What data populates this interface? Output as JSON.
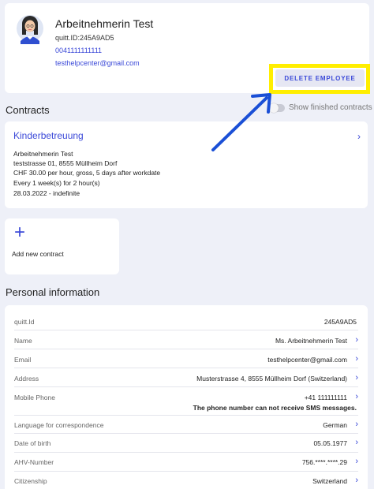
{
  "employee": {
    "name": "Arbeitnehmerin Test",
    "id": "quitt.ID:245A9AD5",
    "phone": "0041111111111",
    "email": "testhelpcenter@gmail.com"
  },
  "actions": {
    "delete_label": "DELETE EMPLOYEE"
  },
  "contracts": {
    "title": "Contracts",
    "toggle_label": "Show finished contracts",
    "toggle_on": false,
    "items": [
      {
        "title": "Kinderbetreuung",
        "employee": "Arbeitnehmerin Test",
        "address": "teststrasse 01, 8555 Müllheim Dorf",
        "pay": "CHF 30.00 per hour, gross, 5 days after workdate",
        "schedule": "Every 1 week(s) for 2 hour(s)",
        "period": "28.03.2022 - indefinite"
      }
    ],
    "add_label": "Add new contract"
  },
  "personal": {
    "title": "Personal information",
    "rows": [
      {
        "label": "quitt.Id",
        "value": "245A9AD5"
      },
      {
        "label": "Name",
        "value": "Ms. Arbeitnehmerin Test"
      },
      {
        "label": "Email",
        "value": "testhelpcenter@gmail.com"
      },
      {
        "label": "Address",
        "value": "Musterstrasse 4, 8555 Müllheim Dorf (Switzerland)"
      },
      {
        "label": "Mobile Phone",
        "value": "+41 111111111",
        "note": "The phone number can not receive SMS messages."
      },
      {
        "label": "Language for correspondence",
        "value": "German"
      },
      {
        "label": "Date of birth",
        "value": "05.05.1977"
      },
      {
        "label": "AHV-Number",
        "value": "756.****.****.29"
      },
      {
        "label": "Citizenship",
        "value": "Switzerland"
      }
    ]
  },
  "colors": {
    "accent": "#3b49d8",
    "highlight": "#ffee00",
    "background": "#eef0f8"
  },
  "icons": {
    "avatar": "woman-avatar",
    "chevron": "chevron-right-icon",
    "plus": "plus-icon",
    "arrow": "annotation-arrow"
  }
}
